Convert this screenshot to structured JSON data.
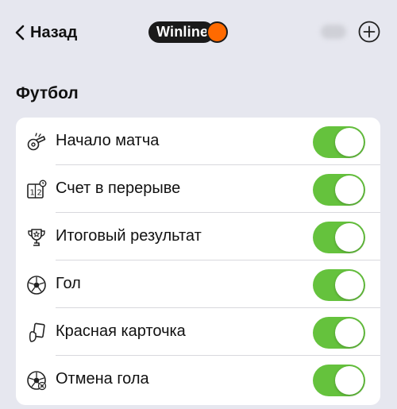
{
  "header": {
    "back_label": "Назад",
    "back_icon": "chevron-left-icon",
    "logo_text": "Winline",
    "add_icon": "plus-circle-icon"
  },
  "section": {
    "title": "Футбол"
  },
  "colors": {
    "background": "#e6e7ef",
    "toggle_on": "#65c23d",
    "logo_accent": "#ff6a00"
  },
  "settings": [
    {
      "label": "Начало матча",
      "icon": "whistle-icon",
      "enabled": true
    },
    {
      "label": "Счет в перерыве",
      "icon": "scoreboard-icon",
      "enabled": true
    },
    {
      "label": "Итоговый результат",
      "icon": "trophy-icon",
      "enabled": true
    },
    {
      "label": "Гол",
      "icon": "soccer-ball-icon",
      "enabled": true
    },
    {
      "label": "Красная карточка",
      "icon": "red-card-icon",
      "enabled": true
    },
    {
      "label": "Отмена гола",
      "icon": "goal-cancel-icon",
      "enabled": true
    }
  ]
}
